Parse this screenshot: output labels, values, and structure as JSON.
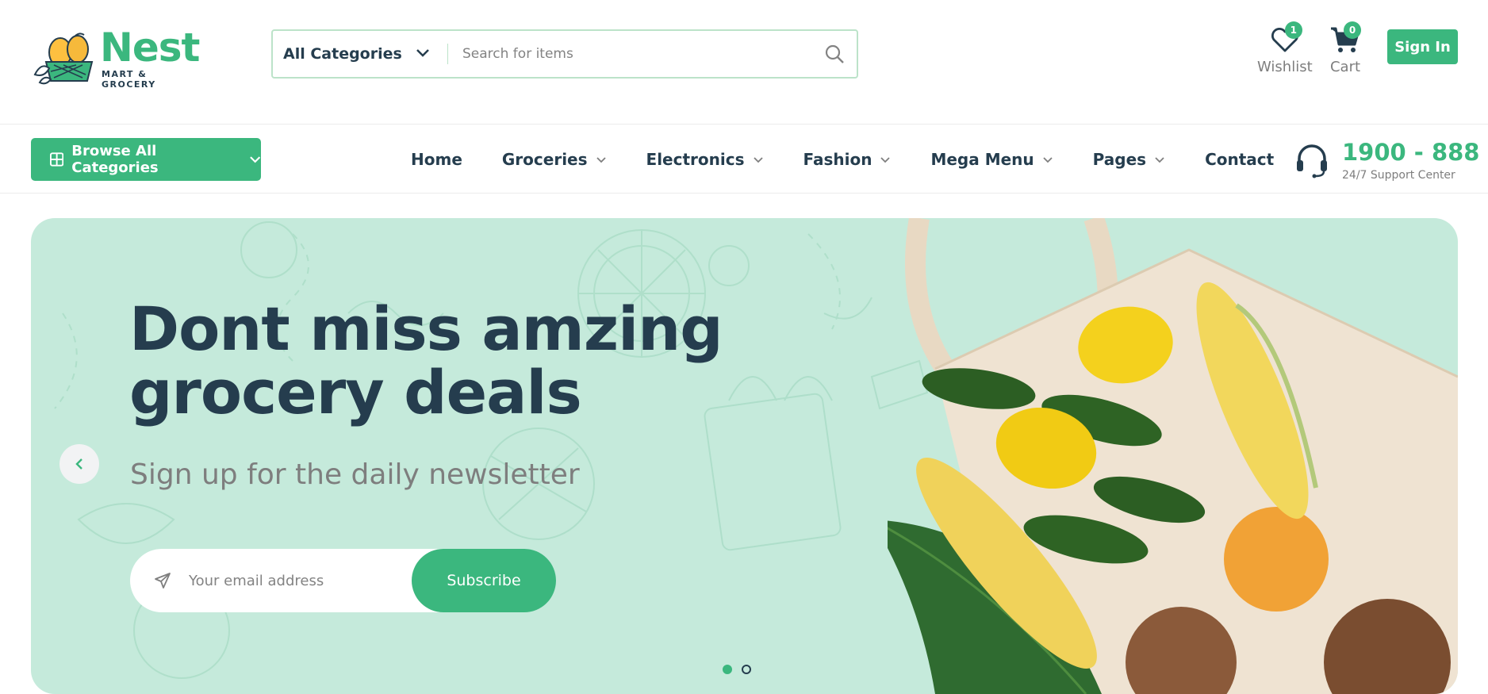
{
  "brand": {
    "name": "Nest",
    "tagline": "MART & GROCERY",
    "accent": "#3bb77e",
    "dark": "#253d4e"
  },
  "search": {
    "category": "All Categories",
    "placeholder": "Search for items"
  },
  "header_actions": {
    "wishlist": {
      "label": "Wishlist",
      "count": "1"
    },
    "cart": {
      "label": "Cart",
      "count": "0"
    },
    "signin": "Sign In"
  },
  "nav": {
    "browse": "Browse All Categories",
    "items": [
      {
        "label": "Home"
      },
      {
        "label": "Groceries"
      },
      {
        "label": "Electronics"
      },
      {
        "label": "Fashion"
      },
      {
        "label": "Mega Menu"
      },
      {
        "label": "Pages"
      },
      {
        "label": "Contact"
      }
    ]
  },
  "support": {
    "phone": "1900 - 888",
    "label": "24/7 Support Center"
  },
  "hero": {
    "title_line1": "Dont miss amzing",
    "title_line2": "grocery deals",
    "subtitle": "Sign up for the daily newsletter",
    "email_placeholder": "Your email address",
    "subscribe": "Subscribe",
    "background": "#c5eadb"
  },
  "icons": [
    "search-icon",
    "chevron-down-icon",
    "heart-icon",
    "cart-icon",
    "grid-icon",
    "headset-icon",
    "send-icon",
    "arrow-left-icon",
    "arrow-right-icon"
  ]
}
